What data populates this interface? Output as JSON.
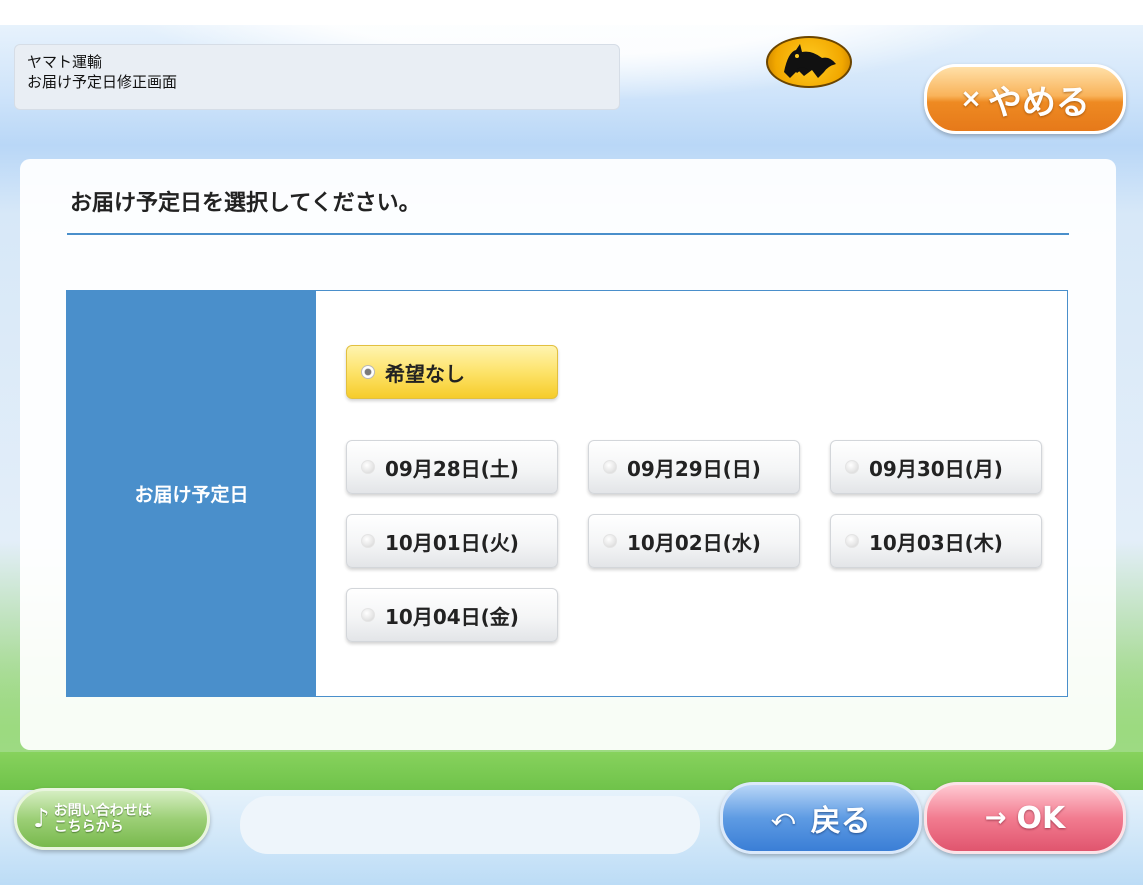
{
  "header": {
    "company": "ヤマト運輸",
    "screen_title": "お届け予定日修正画面",
    "logo_icon": "black-cat-icon",
    "cancel_label": "やめる",
    "cancel_icon": "×"
  },
  "main": {
    "instruction": "お届け予定日を選択してください。",
    "field_label": "お届け予定日",
    "options": [
      {
        "label": "希望なし",
        "selected": true
      },
      {
        "label": "09月28日(土)",
        "selected": false
      },
      {
        "label": "09月29日(日)",
        "selected": false
      },
      {
        "label": "09月30日(月)",
        "selected": false
      },
      {
        "label": "10月01日(火)",
        "selected": false
      },
      {
        "label": "10月02日(水)",
        "selected": false
      },
      {
        "label": "10月03日(木)",
        "selected": false
      },
      {
        "label": "10月04日(金)",
        "selected": false
      }
    ]
  },
  "footer": {
    "contact_line1": "お問い合わせは",
    "contact_line2": "こちらから",
    "back_label": "戻る",
    "back_icon": "⤺",
    "ok_label": "OK",
    "ok_icon": "→"
  },
  "colors": {
    "accent_blue": "#4a8fcb",
    "selected_yellow": "#fde36a",
    "cancel_orange": "#ee8a22",
    "ok_pink": "#e0556e",
    "back_blue": "#3a7ed6",
    "contact_green": "#78b94d"
  }
}
